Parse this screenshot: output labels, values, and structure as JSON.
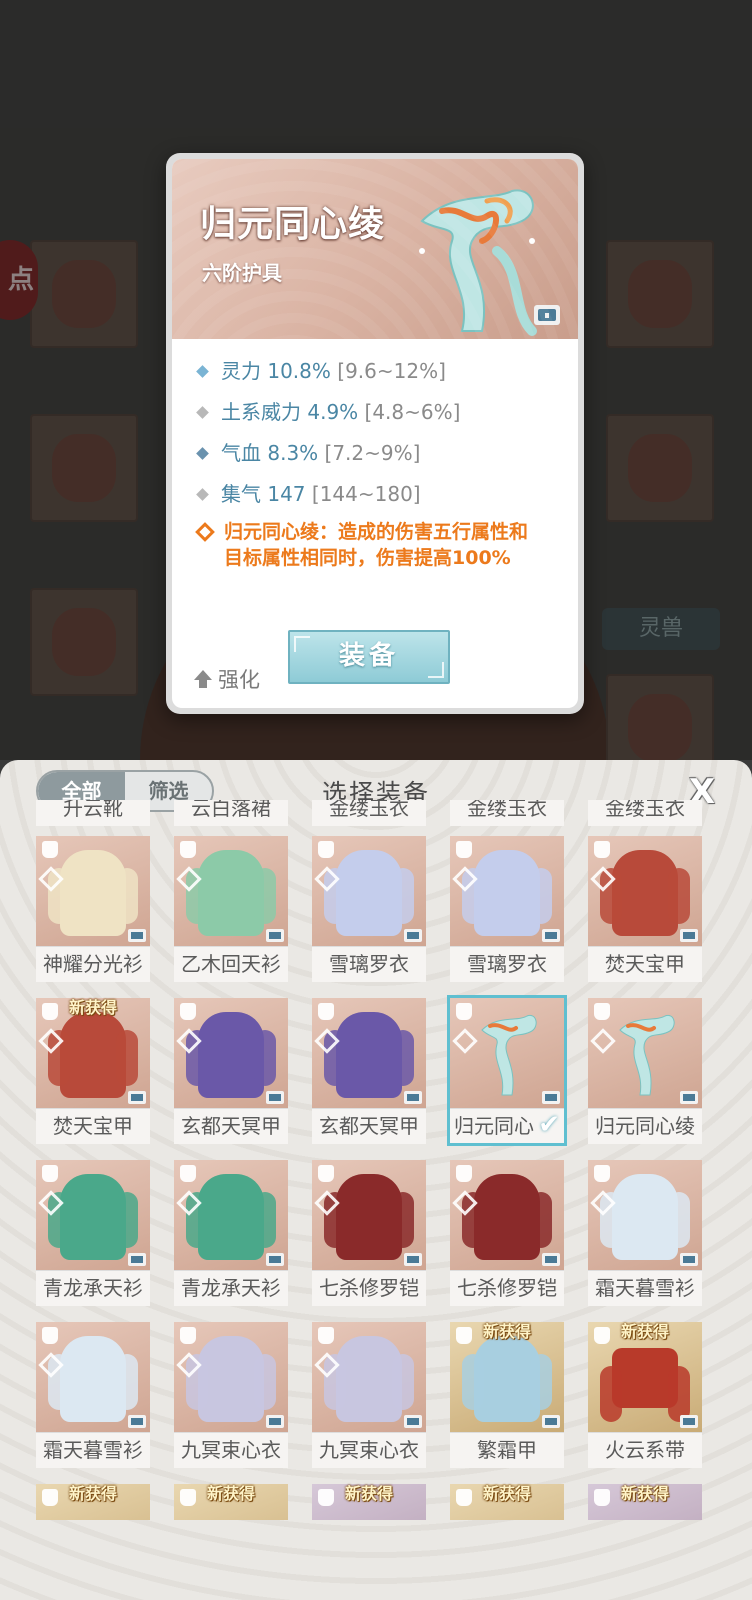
{
  "background": {
    "left_badge": "点",
    "right_button": "灵兽"
  },
  "popup": {
    "name": "归元同心绫",
    "tier": "六阶护具",
    "stats": [
      {
        "label": "灵力 10.8%",
        "range": "[9.6~12%]",
        "color": "#7ab4d4"
      },
      {
        "label": "土系威力 4.9%",
        "range": "[4.8~6%]",
        "color": "#b8b8b8"
      },
      {
        "label": "气血 8.3%",
        "range": "[7.2~9%]",
        "color": "#6a92ae"
      },
      {
        "label": "集气 147",
        "range": "[144~180]",
        "color": "#b8b8b8"
      }
    ],
    "special_line1": "归元同心绫：造成的伤害五行属性和",
    "special_line2": "目标属性相同时，伤害提高100%",
    "strengthen_label": "强化",
    "equip_label": "装备"
  },
  "panel": {
    "filter_all": "全部",
    "filter_select": "筛选",
    "title": "选择装备",
    "close": "X",
    "partial_top_row": [
      "升云靴",
      "云白落裙",
      "金缕玉衣",
      "金缕玉衣",
      "金缕玉衣"
    ],
    "new_badge": "新获得",
    "rows": [
      [
        "神耀分光衫",
        "乙木回天衫",
        "雪璃罗衣",
        "雪璃罗衣",
        "焚天宝甲"
      ],
      [
        "焚天宝甲",
        "玄都天冥甲",
        "玄都天冥甲",
        "归元同心",
        "归元同心绫"
      ],
      [
        "青龙承天衫",
        "青龙承天衫",
        "七杀修罗铠",
        "七杀修罗铠",
        "霜天暮雪衫"
      ],
      [
        "霜天暮雪衫",
        "九冥束心衣",
        "九冥束心衣",
        "繁霜甲",
        "火云系带"
      ]
    ],
    "selected_check": "✔"
  }
}
